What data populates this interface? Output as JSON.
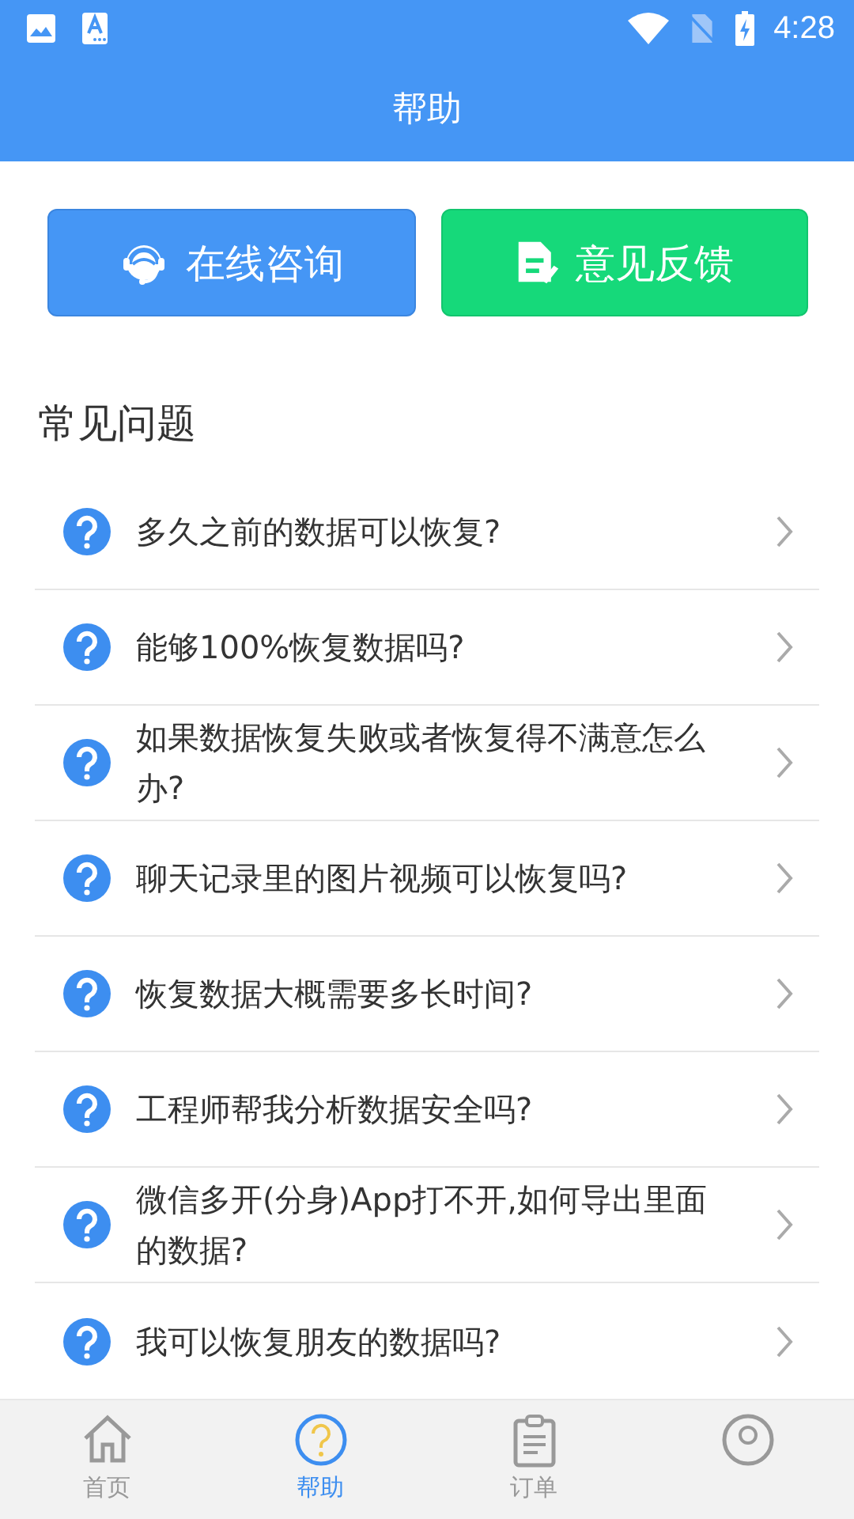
{
  "status_bar": {
    "time": "4:28"
  },
  "header": {
    "title": "帮助"
  },
  "actions": [
    {
      "kind": "consult",
      "label": "在线咨询"
    },
    {
      "kind": "feedback",
      "label": "意见反馈"
    }
  ],
  "faq": {
    "heading": "常见问题",
    "items": [
      {
        "question": "多久之前的数据可以恢复?"
      },
      {
        "question": "能够100%恢复数据吗?"
      },
      {
        "question": "如果数据恢复失败或者恢复得不满意怎么办?"
      },
      {
        "question": "聊天记录里的图片视频可以恢复吗?"
      },
      {
        "question": "恢复数据大概需要多长时间?"
      },
      {
        "question": "工程师帮我分析数据安全吗?"
      },
      {
        "question": "微信多开(分身)App打不开,如何导出里面的数据?"
      },
      {
        "question": "我可以恢复朋友的数据吗?"
      }
    ]
  },
  "tab_bar": [
    {
      "kind": "home",
      "label": "首页",
      "selected": false
    },
    {
      "kind": "help",
      "label": "帮助",
      "selected": true
    },
    {
      "kind": "orders",
      "label": "订单",
      "selected": false
    },
    {
      "kind": "profile",
      "selected": false
    }
  ]
}
